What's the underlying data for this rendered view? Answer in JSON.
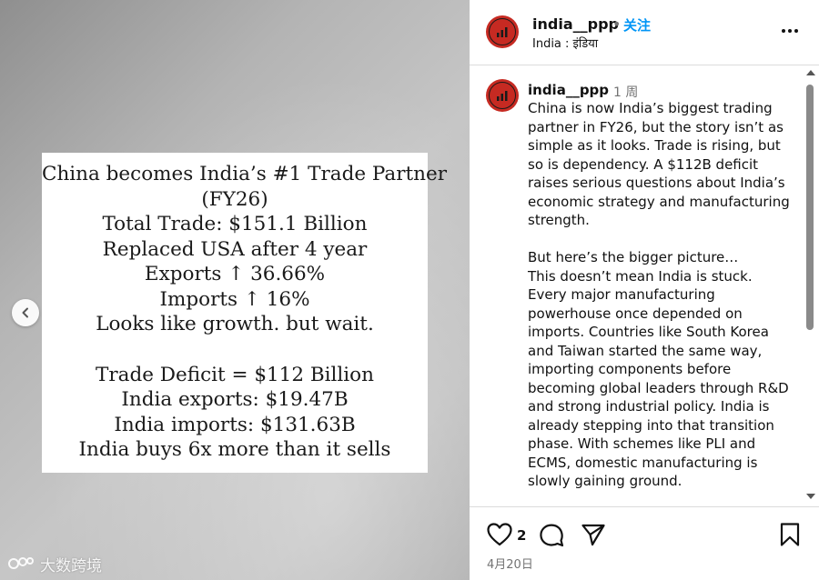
{
  "post_image": {
    "headline": "China becomes India’s #1 Trade Partner",
    "lines": [
      "(FY26)",
      "Total Trade: $151.1 Billion",
      "Replaced USA after 4 year",
      "Exports ↑ 36.66%",
      "Imports ↑ 16%",
      "Looks like growth. but wait."
    ],
    "lines2": [
      "Trade Deficit = $112 Billion",
      "India exports: $19.47B",
      "India imports: $131.63B",
      "India buys 6x more than it sells"
    ],
    "watermark": "大数跨境"
  },
  "header": {
    "username": "india__ppp",
    "separator": "•",
    "follow_label": "关注",
    "location": "India : इंडिया"
  },
  "caption": {
    "username": "india__ppp",
    "time": "1 周",
    "text": "China is now India’s biggest trading partner in FY26, but the story isn’t as simple as it looks. Trade is rising, but so is dependency. A $112B deficit raises serious questions about India’s economic strategy and manufacturing strength.\n\nBut here’s the bigger picture…\nThis doesn’t mean India is stuck. Every major manufacturing powerhouse once depended on imports. Countries like South Korea and Taiwan started the same way, importing components before becoming global leaders through R&D and strong industrial policy. India is already stepping into that transition phase. With schemes like PLI and ECMS, domestic manufacturing is slowly gaining ground."
  },
  "actions": {
    "like_count": "2",
    "date": "4月20日"
  },
  "colors": {
    "follow": "#0095f6",
    "avatar": "#c62a22"
  },
  "icons": [
    "chevron-left-icon",
    "more-icon",
    "heart-icon",
    "comment-icon",
    "share-icon",
    "bookmark-icon"
  ]
}
